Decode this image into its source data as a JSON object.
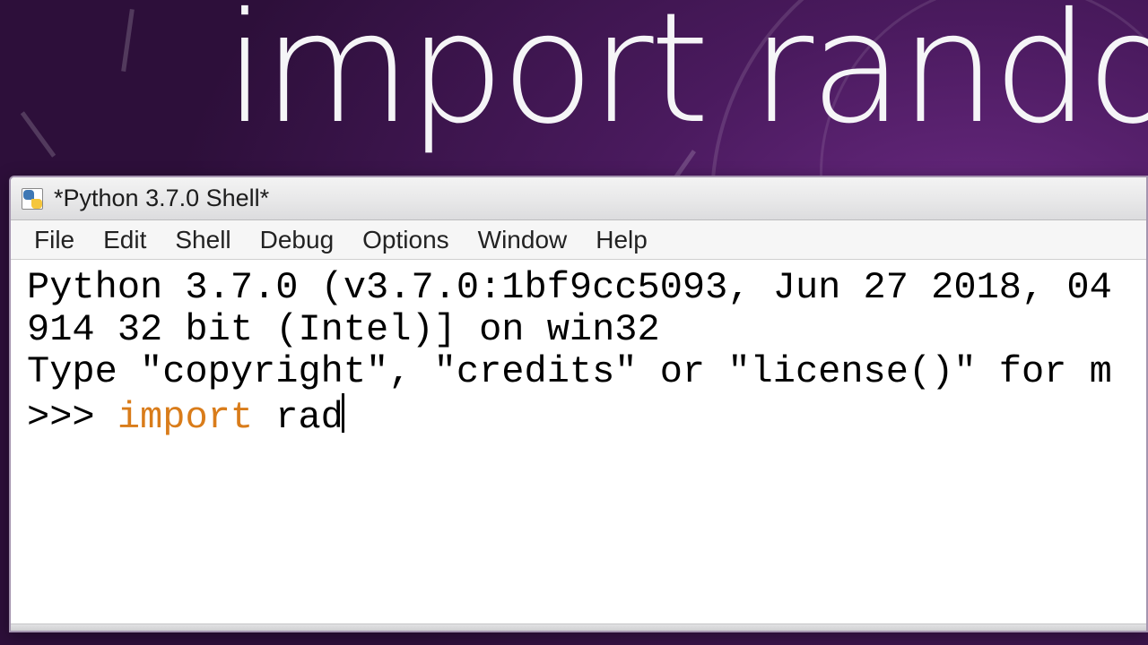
{
  "banner": "import random",
  "window": {
    "title": "*Python 3.7.0 Shell*"
  },
  "menu": {
    "file": "File",
    "edit": "Edit",
    "shell": "Shell",
    "debug": "Debug",
    "options": "Options",
    "window": "Window",
    "help": "Help"
  },
  "shell": {
    "line1": "Python 3.7.0 (v3.7.0:1bf9cc5093, Jun 27 2018, 04",
    "line2": "914 32 bit (Intel)] on win32",
    "line3": "Type \"copyright\", \"credits\" or \"license()\" for m",
    "prompt": ">>> ",
    "keyword": "import",
    "typed": " rad"
  }
}
